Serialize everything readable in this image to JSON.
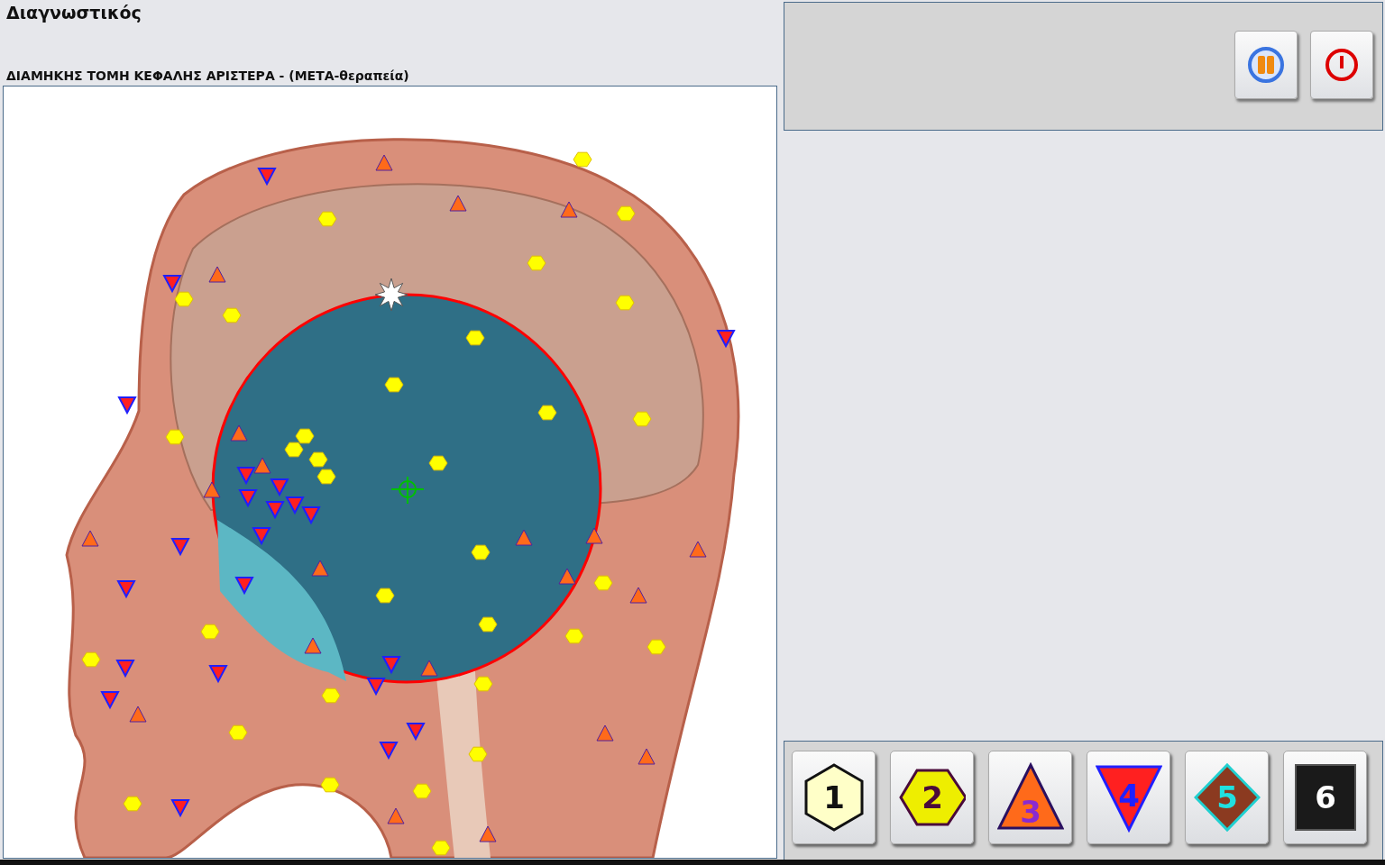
{
  "title": "Διαγνωστικός",
  "image_caption": "ΔΙΑΜΗΚΗΣ ΤΟΜΗ ΚΕΦΑΛΗΣ ΑΡΙΣΤΕΡΑ - (ΜΕΤΑ-θεραπεία)",
  "toolbar_buttons": [
    {
      "kind": "pause"
    },
    {
      "kind": "power"
    }
  ],
  "marker_buttons": [
    {
      "label": "1",
      "kind": "hexagon",
      "color": "#ffffc8"
    },
    {
      "label": "2",
      "kind": "hexagon-flat",
      "color": "#eeee00"
    },
    {
      "label": "3",
      "kind": "triangle-up",
      "color": "#ff6a1a"
    },
    {
      "label": "4",
      "kind": "triangle-down",
      "color": "#ff2020"
    },
    {
      "label": "5",
      "kind": "diamond",
      "color": "#8b3a20"
    },
    {
      "label": "6",
      "kind": "square",
      "color": "#1a1a1a"
    }
  ]
}
